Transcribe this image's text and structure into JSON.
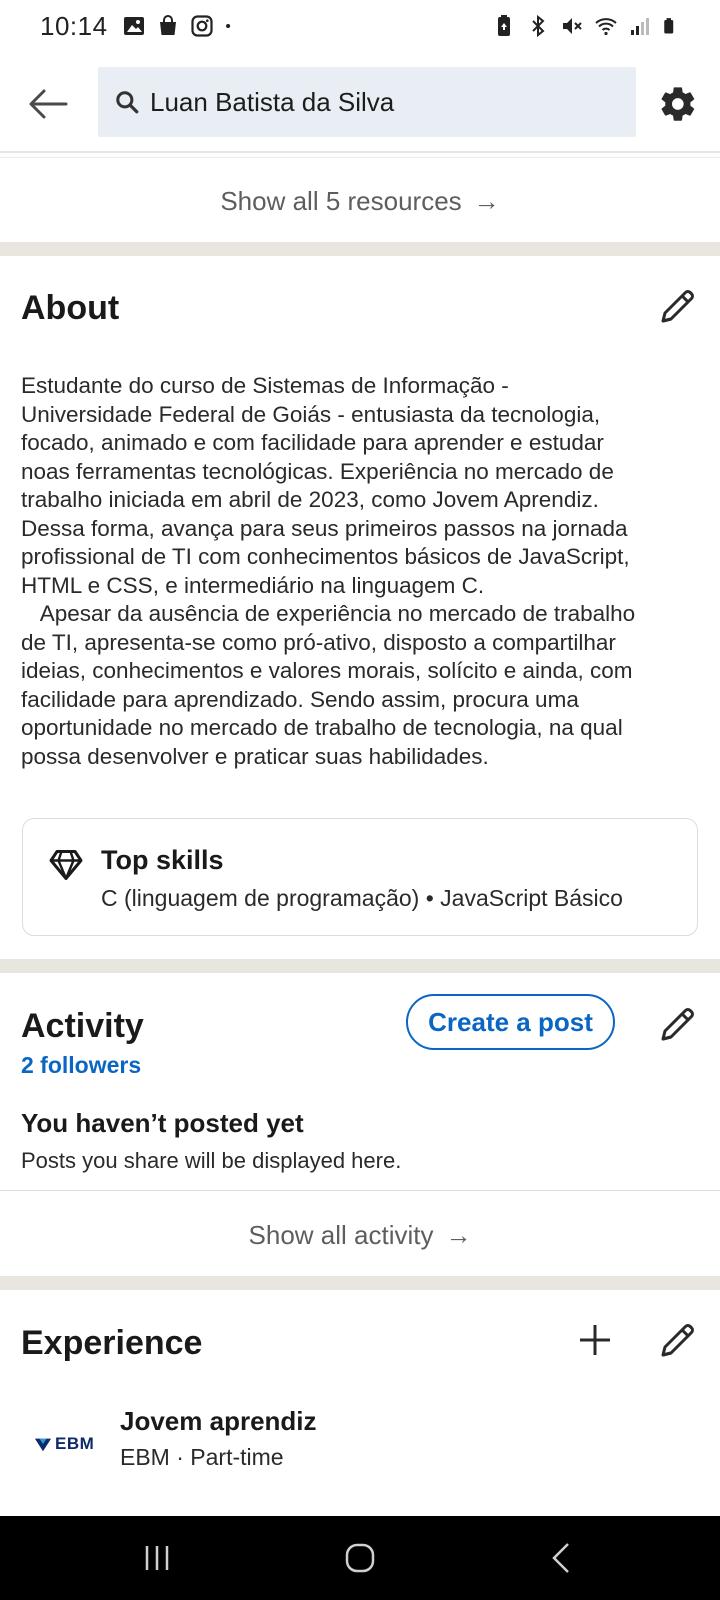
{
  "status_bar": {
    "time": "10:14",
    "left_icons": [
      "gallery-icon",
      "shopping-bag-icon",
      "instagram-icon",
      "dot-icon"
    ],
    "right_icons": [
      "battery-saver-icon",
      "bluetooth-icon",
      "mute-icon",
      "wifi-icon",
      "signal-icon",
      "battery-icon"
    ]
  },
  "header": {
    "search_query": "Luan Batista da Silva"
  },
  "resources": {
    "show_all_label": "Show all 5 resources",
    "arrow": "→"
  },
  "about": {
    "title": "About",
    "text": "Estudante do curso de Sistemas de Informação -\nUniversidade Federal de Goiás - entusiasta da tecnologia,\nfocado, animado e com facilidade para aprender e estudar\nnoas ferramentas tecnológicas. Experiência no mercado de\ntrabalho iniciada em abril de 2023, como Jovem Aprendiz.\nDessa forma, avança para seus primeiros passos na jornada\nprofissional de TI com conhecimentos básicos de JavaScript,\nHTML e CSS, e intermediário na linguagem C.\n   Apesar da ausência de experiência no mercado de trabalho\nde TI, apresenta-se como pró-ativo, disposto a compartilhar\nideias, conhecimentos e valores morais, solícito e ainda, com\nfacilidade para aprendizado. Sendo assim, procura uma\noportunidade no mercado de trabalho de tecnologia, na qual\npossa desenvolver e praticar suas habilidades.",
    "top_skills_title": "Top skills",
    "top_skills_list": "C (linguagem de programação) • JavaScript Básico"
  },
  "activity": {
    "title": "Activity",
    "create_post_label": "Create a post",
    "followers": "2 followers",
    "empty_title": "You haven’t posted yet",
    "empty_sub": "Posts you share will be displayed here.",
    "show_all_label": "Show all activity",
    "arrow": "→"
  },
  "experience": {
    "title": "Experience",
    "items": [
      {
        "logo_text": "EBM",
        "role": "Jovem aprendiz",
        "company": "EBM · Part-time"
      }
    ]
  },
  "colors": {
    "accent": "#0a66c2",
    "divider": "#e9e5df",
    "search_bg": "#e8eef3"
  }
}
